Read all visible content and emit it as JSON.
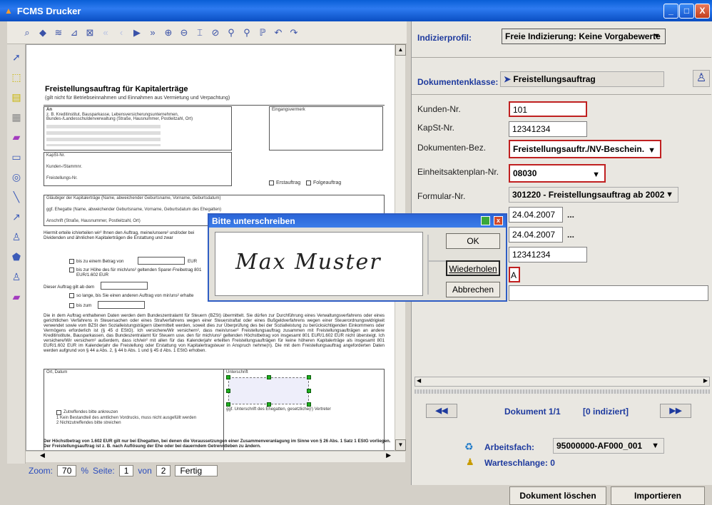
{
  "window": {
    "title": "FCMS Drucker",
    "min": "_",
    "max": "□",
    "close": "X"
  },
  "toolbar": {
    "icons": [
      "zoom-page-icon",
      "fit-width-icon",
      "stack-icon",
      "select-icon",
      "chart-icon",
      "first-page-icon",
      "prev-page-icon",
      "next-page-icon",
      "last-page-icon",
      "zoom-in-icon",
      "zoom-out-icon",
      "crop-icon",
      "zoom-select-icon",
      "pan-icon",
      "search-icon",
      "search-next-icon",
      "undo-icon",
      "redo-icon"
    ]
  },
  "document": {
    "title": "Freistellungsauftrag für Kapitalerträge",
    "subtitle": "(gilt nicht für Betriebseinnahmen und Einnahmen aus Vermietung und Verpachtung)",
    "an_label": "An",
    "an_text": "z. B. Kreditinstitut, Bausparkasse, Lebensversicherungsunternehmen, Bundes-/Landesschuldenverwaltung (Straße, Hausnummer, Postleitzahl, Ort)",
    "eingangsvermerk": "Eingangsvermerk",
    "kapst": "KapSt-Nr.",
    "kunden": "Kunden-/Stammnr.",
    "freistellung_nr": "Freistellungs-Nr.",
    "erstauftrag": "Erstauftrag",
    "folgeauftrag": "Folgeauftrag",
    "glaeubiger": "Gläubiger der Kapitalerträge (Name, abweichender Geburtsname, Vorname, Geburtsdatum)",
    "ehegatte": "ggf. Ehegatte (Name, abweichender Geburtsname, Vorname, Geburtsdatum des Ehegatten)",
    "anschrift": "Anschrift (Straße, Hausnummer, Postleitzahl, Ort)",
    "hiermit": "Hiermit erteile ich/erteilen wir² Ihnen den Auftrag, meine/unsere² und/oder bei Dividenden und ähnlichen Kapitalerträgen die Erstattung und zwar",
    "bis_betrag": "bis zu einem Betrag von",
    "bis_hoehe": "bis zur Höhe des für mich/uns² geltenden Sparer-Freibetrag 801 EUR/1.602 EUR",
    "gilt_ab": "Dieser Auftrag gilt ab dem",
    "so_lange": "so lange, bis Sie einen anderen Auftrag von mir/uns² erhalte",
    "bis_zum": "bis zum",
    "body_text": "Die in dem Auftrag enthaltenen Daten werden dem Bundeszentralamt für Steuern (BZSt) übermittelt. Sie dürfen zur Durchführung eines Verwaltungsverfahrens oder eines gerichtlichen Verfahrens in Steuersachen oder eines Strafverfahrens wegen einer Steuerstraftat oder eines Bußgeldverfahrens wegen einer Steuerordnungswidrigkeit verwendet sowie vom BZSt den Sozialleistungsträgern übermittelt werden, soweit dies zur Überprüfung des bei der Sozialleistung zu berücksichtigenden Einkommens oder Vermögens erforderlich ist (§ 45 d EStG). Ich versichere/Wir versichern², dass mein/unser² Freistellungsauftrag zusammen mit Freistellungsaufträgen an andere Kreditinstitute, Bausparkassen, das Bundeszentralamt für Steuern usw. den für mich/uns² geltenden Höchstbetrag von insgesamt 801 EUR/1.602 EUR nicht übersteigt. Ich versichere/Wir versichern² außerdem, dass ich/wir² mit allen für das Kalenderjahr erteilten Freistellungsaufträgen für keine höheren Kapitalerträge als insgesamt 801 EUR/1.602 EUR im Kalenderjahr die Freistellung oder Erstattung von Kapitalertragsteuer in Anspruch nehme(n). Die mit dem Freistellungsauftrag angeforderten Daten werden aufgrund von § 44 a Abs. 2, § 44 b Abs. 1 und § 45 d Abs. 1 EStG erhoben.",
    "ort_datum": "Ort, Datum",
    "unterschrift": "Unterschrift",
    "unterschrift_sub": "ggf. Unterschrift des Ehegatten, gesetzliche(r) Vertreter",
    "footnote1": "Zutreffendes bitte ankreuzen",
    "footnote2": "1 Kein Bestandteil des amtlichen Vordrucks, muss nicht ausgefüllt werden",
    "footnote3": "2 Nichtzutreffendes bitte streichen",
    "bottom": "Der Höchstbetrag von 1.602 EUR gilt nur bei Ehegatten, bei denen die Voraussetzungen einer Zusammenveranlagung im Sinne von § 26 Abs. 1 Satz 1 EStG vorliegen. Der Freistellungsauftrag ist z. B. nach Auflösung der Ehe oder bei dauerndem Getrenntleben zu ändern.",
    "eur": "EUR"
  },
  "status": {
    "zoom_label": "Zoom:",
    "zoom": "70",
    "pct": "%",
    "seite_label": "Seite:",
    "page": "1",
    "von": "von",
    "total": "2",
    "state": "Fertig"
  },
  "panel": {
    "profil_label": "Indizierprofil:",
    "profil_value": "Freie Indizierung: Keine Vorgabewerte",
    "klasse_label": "Dokumentenklasse:",
    "klasse_value": "Freistellungsauftrag",
    "fields": [
      {
        "label": "Kunden-Nr.",
        "value": "101"
      },
      {
        "label": "KapSt-Nr.",
        "value": "12341234"
      },
      {
        "label": "Dokumenten-Bez.",
        "value": "Freistellungsauftr./NV-Beschein."
      },
      {
        "label": "Einheitsaktenplan-Nr.",
        "value": "08030"
      },
      {
        "label": "Formular-Nr.",
        "value": "301220 - Freistellungsauftrag ab 2002"
      }
    ],
    "date1": "24.04.2007",
    "date2": "24.04.2007",
    "dots": "...",
    "num": "12341234",
    "letter": "A",
    "nav_first": "◀◀",
    "nav_last": "▶▶",
    "dokument": "Dokument 1/1",
    "indiziert": "[0 indiziert]",
    "arbeitsfach_label": "Arbeitsfach:",
    "arbeitsfach_value": "95000000-AF000_001",
    "warteschlange": "Warteschlange: 0"
  },
  "buttons": {
    "loeschen": "Dokument löschen",
    "importieren": "Importieren"
  },
  "dialog": {
    "title": "Bitte unterschreiben",
    "signature": "Max Muster",
    "ok": "OK",
    "wiederholen": "Wiederholen",
    "abbrechen": "Abbrechen"
  }
}
